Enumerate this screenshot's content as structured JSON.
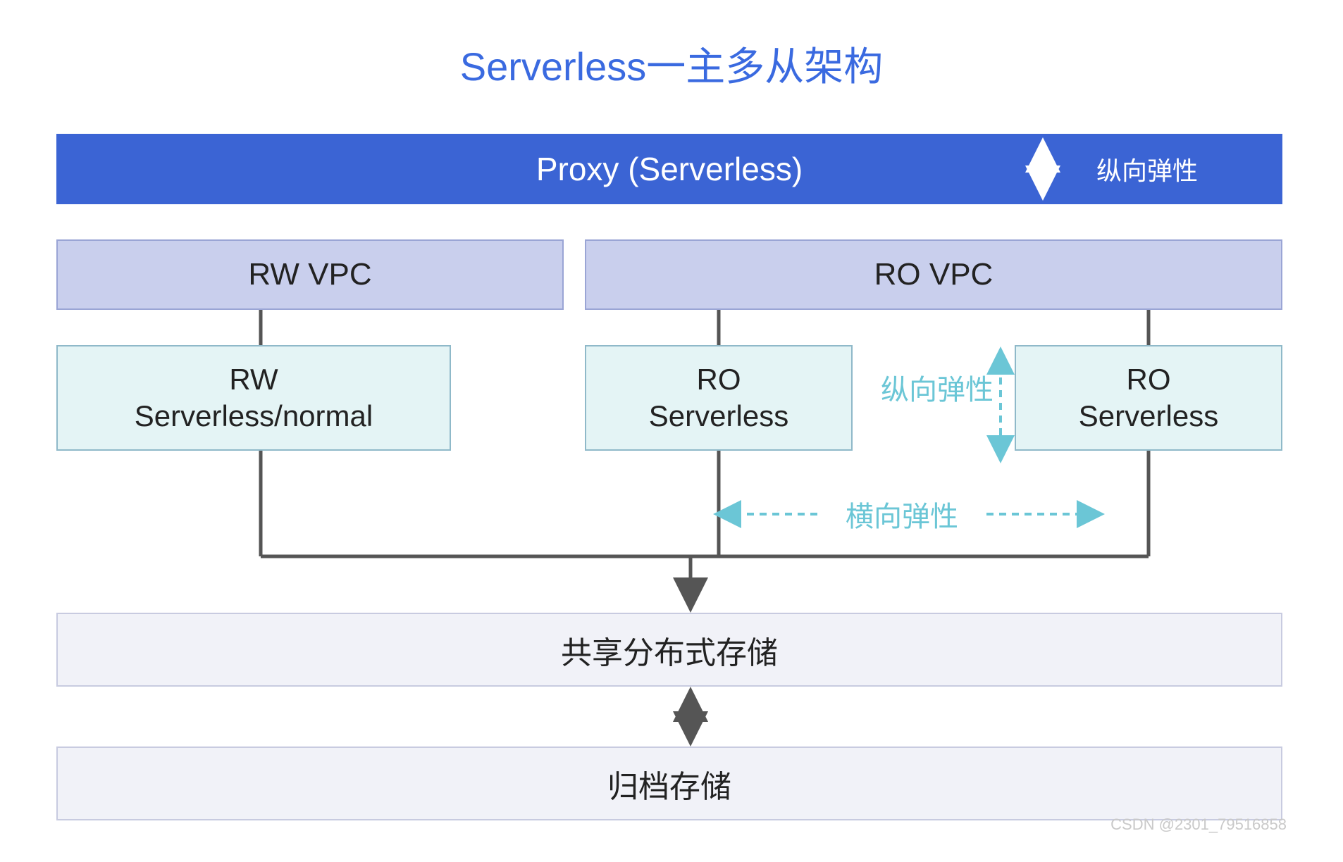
{
  "title": "Serverless一主多从架构",
  "proxy": {
    "label": "Proxy (Serverless)",
    "elastic": "纵向弹性"
  },
  "vpc": {
    "rw": "RW VPC",
    "ro": "RO VPC"
  },
  "nodes": {
    "rw": "RW\nServerless/normal",
    "ro1": "RO\nServerless",
    "ro2": "RO\nServerless"
  },
  "elastic": {
    "vertical": "纵向弹性",
    "horizontal": "横向弹性"
  },
  "storage": {
    "shared": "共享分布式存储",
    "archive": "归档存储"
  },
  "watermark": "CSDN @2301_79516858"
}
